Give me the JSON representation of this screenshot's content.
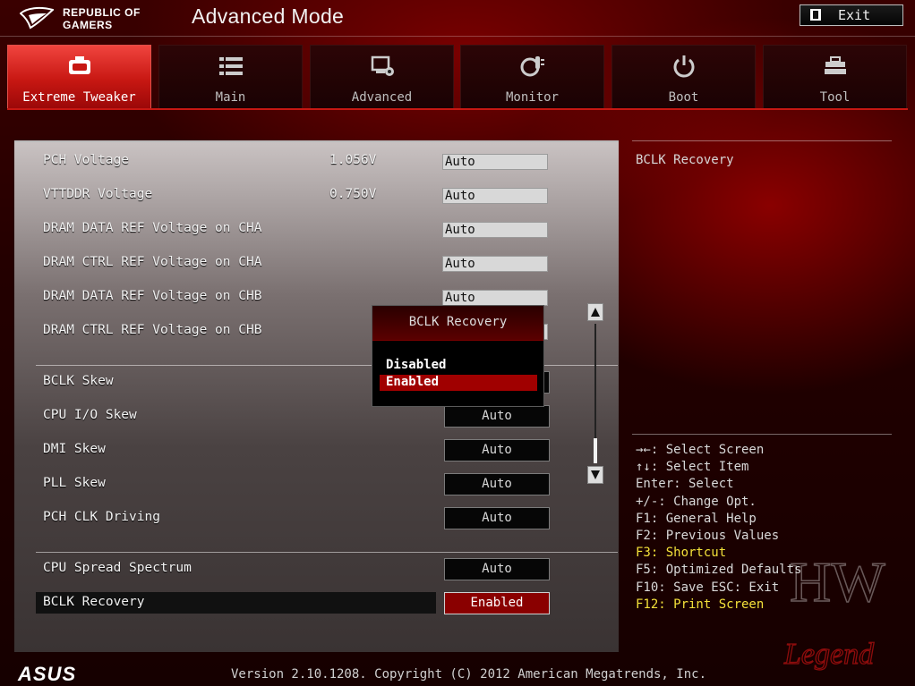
{
  "header": {
    "brand_line1": "REPUBLIC OF",
    "brand_line2": "GAMERS",
    "mode_title": "Advanced Mode",
    "exit_label": "Exit"
  },
  "tabs": [
    {
      "label": "Extreme Tweaker",
      "icon": "tweaker-icon",
      "active": true
    },
    {
      "label": "Main",
      "icon": "list-icon",
      "active": false
    },
    {
      "label": "Advanced",
      "icon": "advanced-icon",
      "active": false
    },
    {
      "label": "Monitor",
      "icon": "thermometer-icon",
      "active": false
    },
    {
      "label": "Boot",
      "icon": "power-icon",
      "active": false
    },
    {
      "label": "Tool",
      "icon": "tool-icon",
      "active": false
    }
  ],
  "settings": {
    "voltage_group": [
      {
        "label": "PCH Voltage",
        "value": "1.056V",
        "setting": "Auto"
      },
      {
        "label": "VTTDDR Voltage",
        "value": "0.750V",
        "setting": "Auto"
      },
      {
        "label": "DRAM DATA REF Voltage on CHA",
        "setting": "Auto"
      },
      {
        "label": "DRAM CTRL REF Voltage on CHA",
        "setting": "Auto"
      },
      {
        "label": "DRAM DATA REF Voltage on CHB",
        "setting": "Auto"
      },
      {
        "label": "DRAM CTRL REF Voltage on CHB",
        "setting": ""
      }
    ],
    "skew_group": [
      {
        "label": "BCLK Skew",
        "setting": ""
      },
      {
        "label": "CPU I/O Skew",
        "setting": "Auto"
      },
      {
        "label": "DMI Skew",
        "setting": "Auto"
      },
      {
        "label": "PLL Skew",
        "setting": "Auto"
      },
      {
        "label": "PCH CLK Driving",
        "setting": "Auto"
      }
    ],
    "spread_group": [
      {
        "label": "CPU Spread Spectrum",
        "setting": "Auto"
      },
      {
        "label": "BCLK Recovery",
        "setting": "Enabled"
      }
    ]
  },
  "popup": {
    "title": "BCLK Recovery",
    "options": [
      "Disabled",
      "Enabled"
    ],
    "selected": "Enabled"
  },
  "help": {
    "title": "BCLK Recovery"
  },
  "keys": [
    "→←: Select Screen",
    "↑↓: Select Item",
    "Enter: Select",
    "+/-: Change Opt.",
    "F1: General Help",
    "F2: Previous Values",
    "F3: Shortcut",
    "F5: Optimized Defaults",
    "F10: Save  ESC: Exit",
    "F12: Print Screen"
  ],
  "footer": {
    "logo": "ASUS",
    "version": "Version 2.10.1208. Copyright (C) 2012 American Megatrends, Inc."
  },
  "watermark": {
    "line1": "HW",
    "line2": "Legend"
  },
  "colors": {
    "accent_red": "#c71712",
    "selected_option": "#a00000",
    "highlight_key": "#f4e13a"
  }
}
